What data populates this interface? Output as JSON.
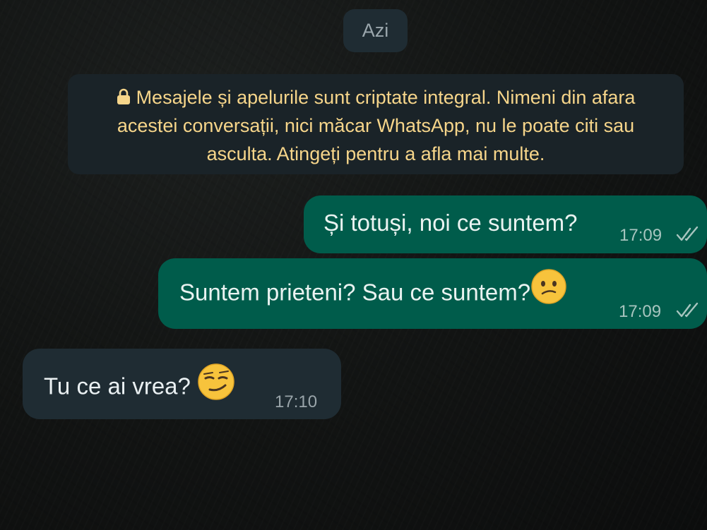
{
  "date_label": "Azi",
  "encryption_notice": "Mesajele și apelurile sunt criptate integral. Nimeni din afara acestei conversații, nici măcar WhatsApp, nu le poate citi sau asculta. Atingeți pentru a afla mai multe.",
  "messages": [
    {
      "direction": "outgoing",
      "text": "Și totuși, noi ce suntem?",
      "time": "17:09",
      "status": "read",
      "status_icon": "double-check-icon"
    },
    {
      "direction": "outgoing",
      "text": "Suntem prieteni? Sau ce suntem?",
      "emoji": "confused-face-emoji",
      "time": "17:09",
      "status": "read",
      "status_icon": "double-check-icon"
    },
    {
      "direction": "incoming",
      "text": "Tu ce ai vrea?",
      "emoji": "smirking-face-emoji",
      "time": "17:10"
    }
  ],
  "colors": {
    "outgoing_bubble": "#005c4b",
    "incoming_bubble": "#1f2c33",
    "notice_text": "#f6d58a"
  }
}
